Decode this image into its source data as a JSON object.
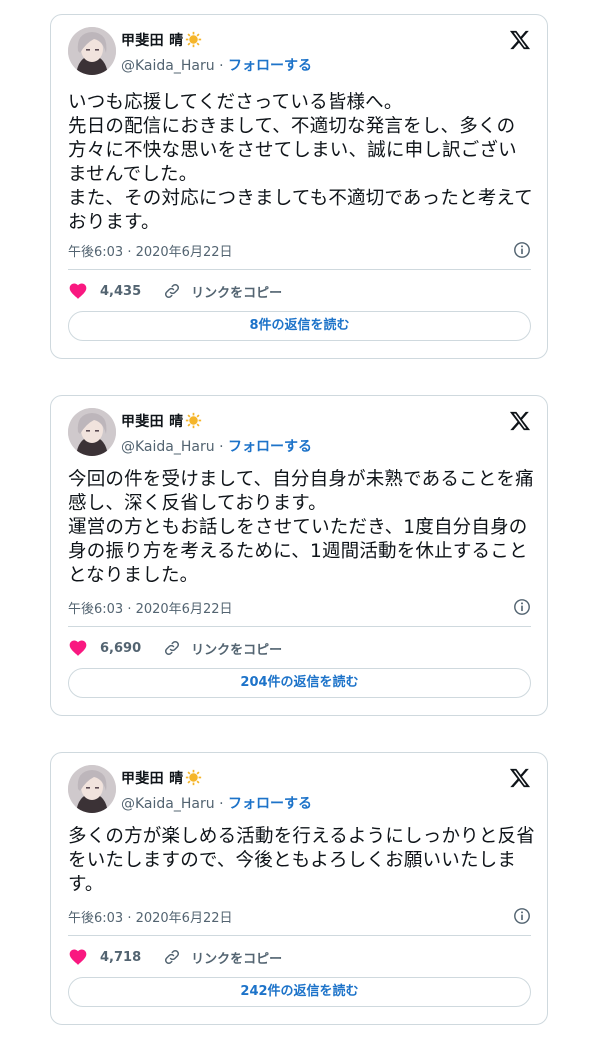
{
  "tweets": [
    {
      "display_name": "甲斐田 晴",
      "handle": "@Kaida_Haru",
      "separator": "·",
      "follow_label": "フォローする",
      "text": "いつも応援してくださっている皆様へ。\n先日の配信におきまして、不適切な発言をし、多くの方々に不快な思いをさせてしまい、誠に申し訳ございませんでした。\nまた、その対応につきましても不適切であったと考えております。",
      "timestamp": "午後6:03 · 2020年6月22日",
      "likes": "4,435",
      "copy_link_label": "リンクをコピー",
      "replies_label": "8件の返信を読む"
    },
    {
      "display_name": "甲斐田 晴",
      "handle": "@Kaida_Haru",
      "separator": "·",
      "follow_label": "フォローする",
      "text": "今回の件を受けまして、自分自身が未熟であることを痛感し、深く反省しております。\n運営の方ともお話しをさせていただき、1度自分自身の身の振り方を考えるために、1週間活動を休止することとなりました。",
      "timestamp": "午後6:03 · 2020年6月22日",
      "likes": "6,690",
      "copy_link_label": "リンクをコピー",
      "replies_label": "204件の返信を読む"
    },
    {
      "display_name": "甲斐田 晴",
      "handle": "@Kaida_Haru",
      "separator": "·",
      "follow_label": "フォローする",
      "text": "多くの方が楽しめる活動を行えるようにしっかりと反省をいたしますので、今後ともよろしくお願いいたします。",
      "timestamp": "午後6:03 · 2020年6月22日",
      "likes": "4,718",
      "copy_link_label": "リンクをコピー",
      "replies_label": "242件の返信を読む"
    }
  ],
  "colors": {
    "accent": "#1d73c9",
    "like": "#f91880",
    "border": "#cfd9de",
    "muted": "#536471"
  },
  "icons": [
    "x-logo-icon",
    "sun-icon",
    "info-icon",
    "heart-icon",
    "link-icon"
  ]
}
